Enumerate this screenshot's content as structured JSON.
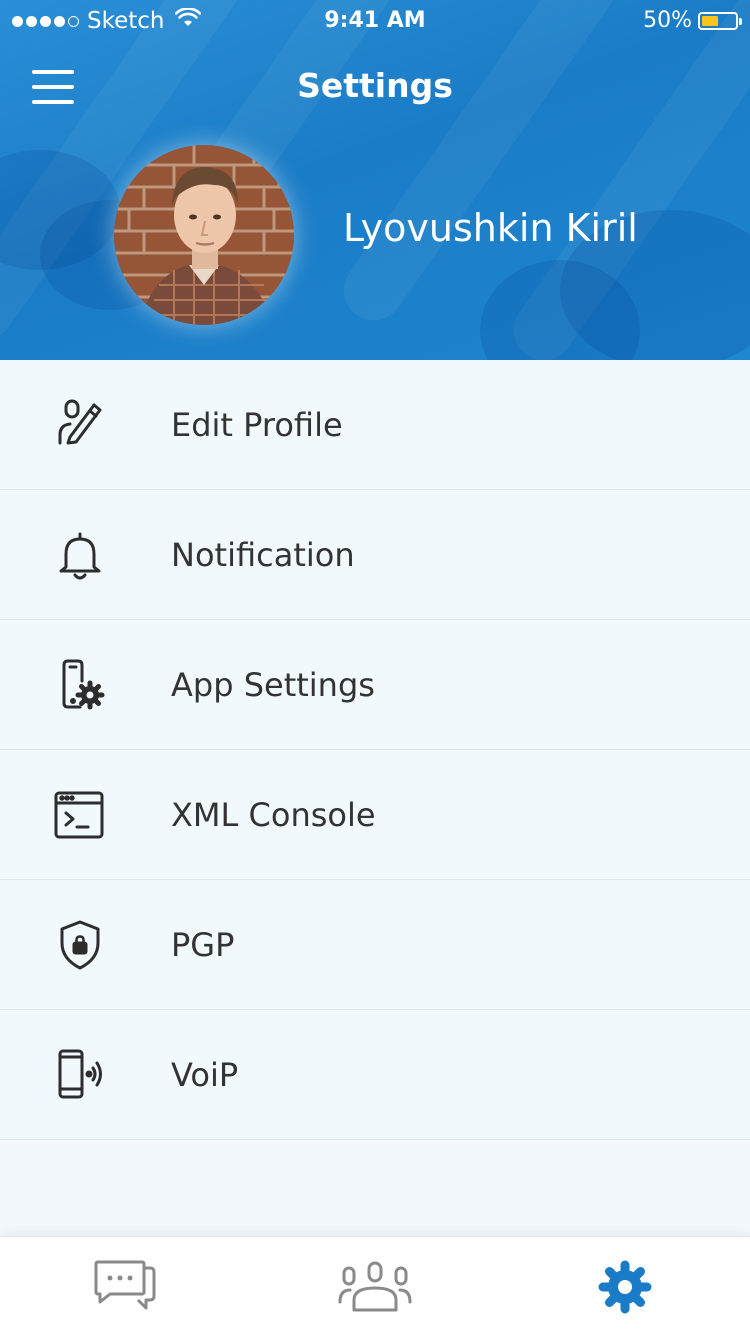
{
  "status_bar": {
    "carrier": "Sketch",
    "time": "9:41 AM",
    "battery_percent": "50%",
    "battery_level": 0.5
  },
  "header": {
    "title": "Settings",
    "user_name": "Lyovushkin Kiril"
  },
  "menu": {
    "items": [
      {
        "label": "Edit Profile",
        "icon": "edit-profile-icon"
      },
      {
        "label": "Notification",
        "icon": "bell-icon"
      },
      {
        "label": "App Settings",
        "icon": "phone-gear-icon"
      },
      {
        "label": "XML Console",
        "icon": "console-icon"
      },
      {
        "label": "PGP",
        "icon": "shield-lock-icon"
      },
      {
        "label": "VoiP",
        "icon": "phone-signal-icon"
      }
    ]
  },
  "tab_bar": {
    "tabs": [
      {
        "name": "chats",
        "icon": "chat-bubbles-icon",
        "active": false
      },
      {
        "name": "contacts",
        "icon": "group-icon",
        "active": false
      },
      {
        "name": "settings",
        "icon": "gear-icon",
        "active": true
      }
    ],
    "active_color": "#1a7cc6",
    "inactive_color": "#8a8a8a"
  },
  "colors": {
    "header_blue": "#1f86d0",
    "battery_fill": "#f8c51c"
  }
}
